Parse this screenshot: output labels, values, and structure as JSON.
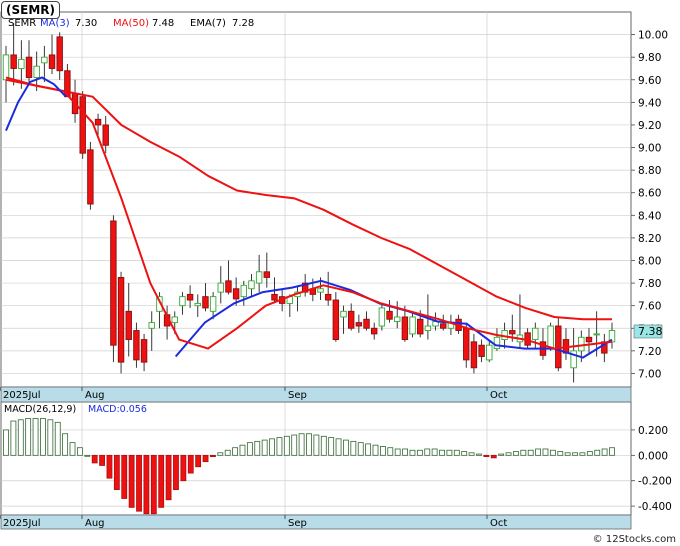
{
  "symbol_box": "(SEMR)",
  "legend": {
    "symbol": "SEMR",
    "ma3": "MA(3)",
    "ma3_val": "7.30",
    "ma50": "MA(50)",
    "ma50_val": "7.48",
    "ema7": "EMA(7)",
    "ema7_val": "7.28"
  },
  "last_price_tag": "7.38",
  "macd_legend": {
    "label": "MACD(26,12,9)",
    "value_label": "MACD:0.056"
  },
  "footer": "© 12Stocks.com",
  "colors": {
    "up": "#33aa33",
    "down": "#ee1111",
    "ma3": "#1a2be0",
    "ma50": "#ee1111",
    "macd_bar": "#336633",
    "axis_band": "#b8dce8",
    "tag": "#99e6e6"
  },
  "chart_data": [
    {
      "type": "candlestick",
      "title": "",
      "x_tick_labels": [
        "2025Jul",
        "Aug",
        "Sep",
        "Oct"
      ],
      "y_ticks": [
        7.0,
        7.2,
        7.4,
        7.6,
        7.8,
        8.0,
        8.2,
        8.4,
        8.6,
        8.8,
        9.0,
        9.2,
        9.4,
        9.6,
        9.8,
        10.0
      ],
      "ylim": [
        6.88,
        10.2
      ],
      "grid": true,
      "ohlc": [
        [
          9.6,
          9.9,
          9.4,
          9.82
        ],
        [
          9.82,
          10.1,
          9.55,
          9.7
        ],
        [
          9.7,
          9.95,
          9.52,
          9.78
        ],
        [
          9.8,
          9.95,
          9.55,
          9.62
        ],
        [
          9.62,
          9.85,
          9.5,
          9.72
        ],
        [
          9.75,
          9.9,
          9.58,
          9.8
        ],
        [
          9.82,
          10.0,
          9.65,
          9.7
        ],
        [
          9.98,
          10.02,
          9.6,
          9.68
        ],
        [
          9.68,
          9.74,
          9.45,
          9.45
        ],
        [
          9.48,
          9.6,
          9.22,
          9.3
        ],
        [
          9.45,
          9.5,
          8.9,
          8.95
        ],
        [
          8.98,
          9.05,
          8.45,
          8.5
        ],
        [
          9.25,
          9.3,
          9.1,
          9.2
        ],
        [
          9.2,
          9.28,
          8.95,
          9.02
        ],
        [
          8.35,
          8.4,
          7.1,
          7.25
        ],
        [
          7.85,
          7.9,
          7.0,
          7.1
        ],
        [
          7.55,
          7.8,
          7.15,
          7.3
        ],
        [
          7.38,
          7.45,
          7.05,
          7.12
        ],
        [
          7.3,
          7.35,
          7.02,
          7.1
        ],
        [
          7.4,
          7.55,
          7.2,
          7.45
        ],
        [
          7.55,
          7.72,
          7.4,
          7.68
        ],
        [
          7.52,
          7.6,
          7.3,
          7.42
        ],
        [
          7.45,
          7.55,
          7.35,
          7.5
        ],
        [
          7.6,
          7.72,
          7.52,
          7.68
        ],
        [
          7.7,
          7.78,
          7.58,
          7.65
        ],
        [
          7.6,
          7.7,
          7.5,
          7.62
        ],
        [
          7.68,
          7.8,
          7.55,
          7.58
        ],
        [
          7.55,
          7.72,
          7.48,
          7.68
        ],
        [
          7.72,
          7.95,
          7.62,
          7.8
        ],
        [
          7.82,
          8.0,
          7.7,
          7.72
        ],
        [
          7.75,
          7.85,
          7.6,
          7.66
        ],
        [
          7.68,
          7.82,
          7.6,
          7.78
        ],
        [
          7.75,
          7.88,
          7.68,
          7.82
        ],
        [
          7.8,
          8.05,
          7.72,
          7.9
        ],
        [
          7.9,
          8.07,
          7.76,
          7.85
        ],
        [
          7.7,
          7.85,
          7.62,
          7.65
        ],
        [
          7.68,
          7.75,
          7.55,
          7.62
        ],
        [
          7.62,
          7.7,
          7.5,
          7.68
        ],
        [
          7.68,
          7.78,
          7.55,
          7.72
        ],
        [
          7.8,
          7.88,
          7.68,
          7.72
        ],
        [
          7.75,
          7.84,
          7.64,
          7.7
        ],
        [
          7.72,
          7.85,
          7.65,
          7.75
        ],
        [
          7.7,
          7.9,
          7.6,
          7.65
        ],
        [
          7.65,
          7.72,
          7.28,
          7.3
        ],
        [
          7.5,
          7.6,
          7.35,
          7.55
        ],
        [
          7.55,
          7.62,
          7.38,
          7.4
        ],
        [
          7.45,
          7.52,
          7.36,
          7.42
        ],
        [
          7.48,
          7.55,
          7.38,
          7.4
        ],
        [
          7.4,
          7.45,
          7.3,
          7.35
        ],
        [
          7.42,
          7.62,
          7.38,
          7.58
        ],
        [
          7.55,
          7.65,
          7.45,
          7.48
        ],
        [
          7.46,
          7.64,
          7.4,
          7.5
        ],
        [
          7.5,
          7.6,
          7.28,
          7.3
        ],
        [
          7.35,
          7.55,
          7.32,
          7.5
        ],
        [
          7.48,
          7.56,
          7.32,
          7.35
        ],
        [
          7.38,
          7.7,
          7.3,
          7.42
        ],
        [
          7.42,
          7.54,
          7.38,
          7.46
        ],
        [
          7.44,
          7.52,
          7.38,
          7.4
        ],
        [
          7.4,
          7.52,
          7.34,
          7.45
        ],
        [
          7.48,
          7.52,
          7.35,
          7.38
        ],
        [
          7.4,
          7.45,
          7.05,
          7.12
        ],
        [
          7.28,
          7.35,
          7.0,
          7.05
        ],
        [
          7.25,
          7.3,
          7.1,
          7.15
        ],
        [
          7.12,
          7.3,
          7.1,
          7.25
        ],
        [
          7.22,
          7.4,
          7.2,
          7.32
        ],
        [
          7.3,
          7.45,
          7.22,
          7.38
        ],
        [
          7.38,
          7.52,
          7.28,
          7.35
        ],
        [
          7.28,
          7.7,
          7.22,
          7.34
        ],
        [
          7.36,
          7.4,
          7.22,
          7.25
        ],
        [
          7.3,
          7.45,
          7.22,
          7.4
        ],
        [
          7.28,
          7.4,
          7.12,
          7.16
        ],
        [
          7.22,
          7.45,
          7.2,
          7.42
        ],
        [
          7.42,
          7.5,
          7.02,
          7.05
        ],
        [
          7.3,
          7.4,
          7.12,
          7.18
        ],
        [
          7.05,
          7.4,
          6.92,
          7.2
        ],
        [
          7.2,
          7.38,
          7.1,
          7.32
        ],
        [
          7.32,
          7.4,
          7.18,
          7.28
        ],
        [
          7.35,
          7.55,
          7.15,
          7.35
        ],
        [
          7.28,
          7.35,
          7.1,
          7.18
        ],
        [
          7.28,
          7.45,
          7.22,
          7.38
        ]
      ],
      "series": [
        {
          "name": "MA(3)",
          "values": [
            7.15,
            7.45,
            7.62,
            7.72,
            7.76,
            7.82,
            7.74,
            7.62,
            7.55,
            7.46,
            7.44,
            7.25,
            7.22,
            7.22,
            7.14,
            7.3
          ]
        },
        {
          "name": "MA(50)",
          "values": [
            9.62,
            9.55,
            9.5,
            9.45,
            9.2,
            9.05,
            8.92,
            8.75,
            8.62,
            8.58,
            8.55,
            8.45,
            8.32,
            8.2,
            8.1,
            7.96,
            7.82,
            7.68,
            7.58,
            7.5,
            7.48,
            7.48
          ]
        },
        {
          "name": "EMA(7)",
          "values": [
            9.6,
            9.55,
            9.5,
            9.22,
            8.55,
            7.8,
            7.3,
            7.22,
            7.4,
            7.6,
            7.7,
            7.78,
            7.72,
            7.62,
            7.55,
            7.48,
            7.4,
            7.34,
            7.3,
            7.22,
            7.25,
            7.28
          ]
        }
      ]
    },
    {
      "type": "bar",
      "title": "",
      "x_tick_labels": [
        "2025Jul",
        "Aug",
        "Sep",
        "Oct"
      ],
      "y_ticks": [
        0.2,
        0.0,
        -0.2,
        -0.4
      ],
      "ylim": [
        -0.47,
        0.42
      ],
      "grid": true,
      "values": [
        0.2,
        0.27,
        0.28,
        0.29,
        0.29,
        0.29,
        0.28,
        0.26,
        0.17,
        0.1,
        0.06,
        0.0,
        -0.06,
        -0.08,
        -0.18,
        -0.27,
        -0.34,
        -0.41,
        -0.44,
        -0.46,
        -0.46,
        -0.41,
        -0.35,
        -0.27,
        -0.2,
        -0.14,
        -0.09,
        -0.05,
        -0.01,
        0.02,
        0.04,
        0.06,
        0.08,
        0.1,
        0.11,
        0.12,
        0.13,
        0.14,
        0.15,
        0.16,
        0.17,
        0.17,
        0.16,
        0.15,
        0.14,
        0.13,
        0.12,
        0.11,
        0.1,
        0.09,
        0.08,
        0.07,
        0.06,
        0.05,
        0.05,
        0.04,
        0.04,
        0.05,
        0.05,
        0.04,
        0.04,
        0.04,
        0.03,
        0.02,
        0.01,
        -0.01,
        -0.02,
        0.01,
        0.02,
        0.03,
        0.04,
        0.04,
        0.05,
        0.05,
        0.04,
        0.03,
        0.02,
        0.02,
        0.02,
        0.03,
        0.04,
        0.05,
        0.06
      ]
    }
  ]
}
